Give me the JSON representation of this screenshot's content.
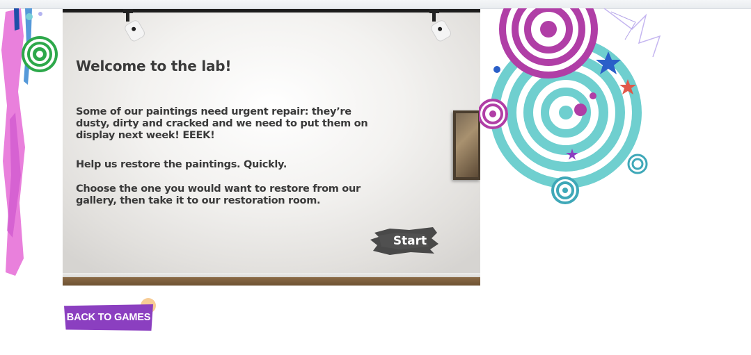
{
  "game": {
    "title": "Welcome to the lab!",
    "paragraphs": [
      "Some of our paintings need urgent repair: they’re dusty, dirty and cracked and we need to put them on display next week! EEEK!",
      "Help us restore the paintings. Quickly.",
      "Choose the one you would want to restore from our gallery, then take it to our restoration room."
    ],
    "start_label": "Start"
  },
  "footer": {
    "back_label": "BACK TO GAMES"
  },
  "colors": {
    "back_button": "#8b3fc0",
    "start_button": "#3c3c3c",
    "swirl_teal": "#6fcfcf",
    "swirl_purple": "#b03ea6",
    "splash_pink": "#e05bd0"
  },
  "icons": {
    "spotlight": "spotlight-icon",
    "swirl": "swirl-decoration",
    "star": "star-icon"
  }
}
